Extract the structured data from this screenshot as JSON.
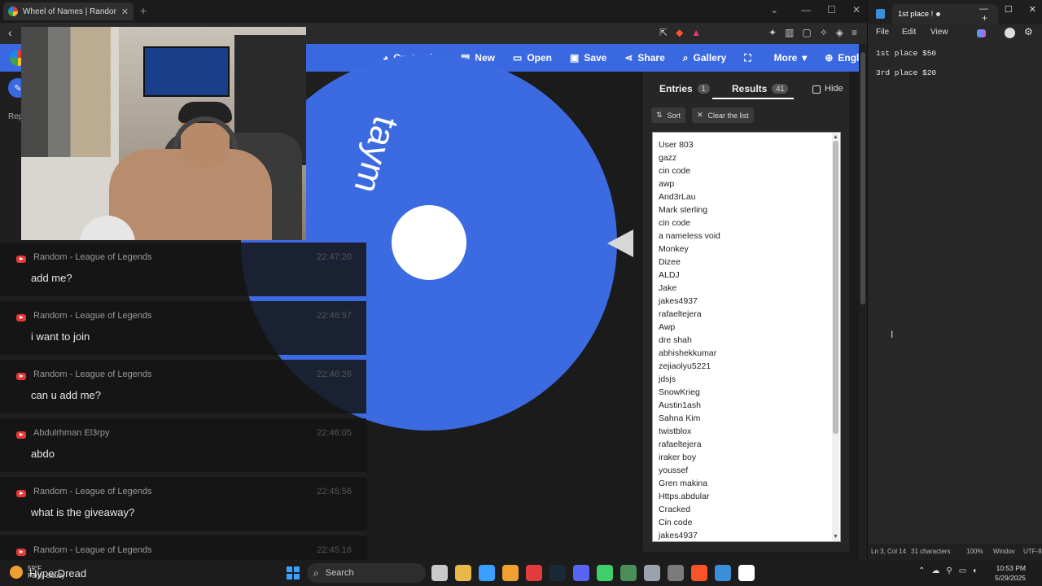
{
  "browser": {
    "tab_title": "Wheel of Names | Random name",
    "tab_close": "✕",
    "new_tab": "+",
    "window_controls": [
      "—",
      "☐",
      "✕"
    ],
    "back": "‹"
  },
  "site": {
    "nav": [
      {
        "icon": "palette-icon",
        "glyph": "◕",
        "label": "Customize"
      },
      {
        "icon": "file-icon",
        "glyph": "▤",
        "label": "New"
      },
      {
        "icon": "folder-icon",
        "glyph": "▭",
        "label": "Open"
      },
      {
        "icon": "save-icon",
        "glyph": "▣",
        "label": "Save"
      },
      {
        "icon": "share-icon",
        "glyph": "⋖",
        "label": "Share"
      },
      {
        "icon": "search-icon",
        "glyph": "⌕",
        "label": "Gallery"
      },
      {
        "icon": "fullscreen-icon",
        "glyph": "⛶",
        "label": ""
      },
      {
        "icon": "caret-down-icon",
        "glyph": "▾",
        "label": "More"
      },
      {
        "icon": "globe-icon",
        "glyph": "⊕",
        "label": "English"
      }
    ],
    "rep_label": "Rep",
    "edit_glyph": "✎"
  },
  "wheel": {
    "segment_label": "taym",
    "color": "#3c6ae0"
  },
  "chat": [
    {
      "author": "Random - League of Legends",
      "time": "22:47:20",
      "text": "add me?"
    },
    {
      "author": "Random - League of Legends",
      "time": "22:46:57",
      "text": "i want to join"
    },
    {
      "author": "Random - League of Legends",
      "time": "22:46:26",
      "text": "can u add me?"
    },
    {
      "author": "Abdulrhman El3rpy",
      "time": "22:46:05",
      "text": "abdo"
    },
    {
      "author": "Random - League of Legends",
      "time": "22:45:56",
      "text": "what is the giveaway?"
    },
    {
      "author": "Random - League of Legends",
      "time": "22:45:16",
      "text": ""
    }
  ],
  "panel": {
    "entries_label": "Entries",
    "entries_count": "1",
    "results_label": "Results",
    "results_count": "41",
    "hide_label": "Hide",
    "sort_label": "Sort",
    "sort_glyph": "⇅",
    "clear_label": "Clear the list",
    "clear_glyph": "✕",
    "results": [
      "User 803",
      "gazz",
      "cin code",
      "awp",
      "And3rLau",
      "Mark sterling",
      "cin code",
      "a nameless void",
      "Monkey",
      "Dizee",
      "ALDJ",
      "Jake",
      "jakes4937",
      "rafaeltejera",
      "Awp",
      "dre shah",
      "abhishekkumar",
      "zejiaolyu5221",
      "jdsjs",
      "SnowKrieg",
      "Austin1ash",
      "Sahna Kim",
      "twistblox",
      "rafaeltejera",
      "iraker boy",
      "youssef",
      "Gren makina",
      "Https.abdular",
      "Cracked",
      "Cin code",
      "jakes4937"
    ]
  },
  "notepad": {
    "tab_title": "1st place !",
    "menu": [
      "File",
      "Edit",
      "View"
    ],
    "lines": [
      "1st place $50",
      "3rd place $20"
    ],
    "status": {
      "position": "Ln 3, Col 14",
      "chars": "31 characters",
      "zoom": "100%",
      "eol": "Windov",
      "encoding": "UTF-8"
    },
    "window_controls": [
      "—",
      "☐",
      "✕"
    ],
    "plus": "+",
    "gear": "⚙"
  },
  "taskbar": {
    "temperature": "59°F",
    "weather_text": "Partly cloudy",
    "overlay_name": "HyperDread",
    "search_label": "Search",
    "time": "10:53 PM",
    "date": "5/29/2025",
    "app_colors": [
      "#c9c9c9",
      "#e8b84a",
      "#3aa0ff",
      "#f0a030",
      "#e23b3b",
      "#1b2838",
      "#5865f2",
      "#3ecf6b",
      "#4a8f5a",
      "#9aa3ad",
      "#7a7a7a",
      "#fb542b",
      "#3b8fd8",
      "#ffffff"
    ],
    "tray": [
      "⌃",
      "☁",
      "⚲",
      "▭",
      "◐"
    ]
  }
}
